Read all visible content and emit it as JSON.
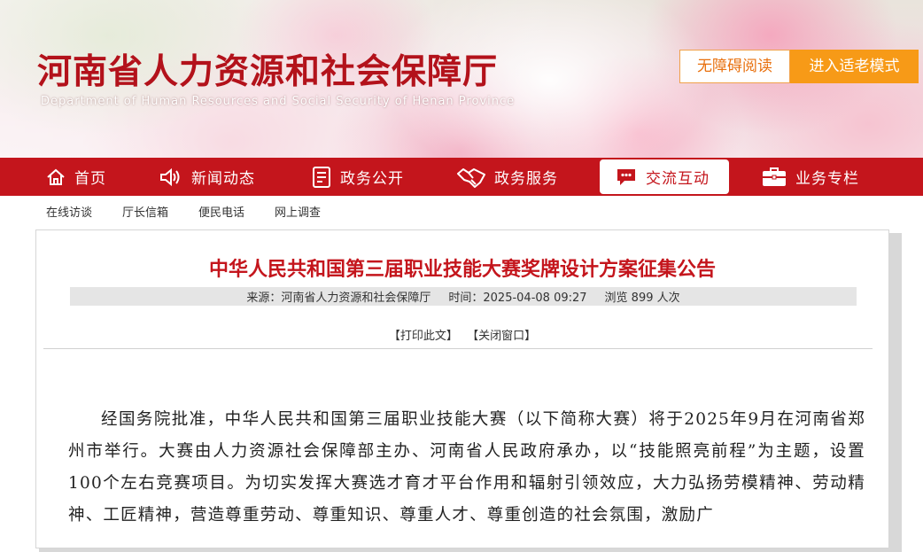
{
  "header": {
    "title": "河南省人力资源和社会保障厅",
    "subtitle": "Department of Human Resources and Social Security of Henan Province",
    "accessibility_label": "无障碍阅读",
    "elder_mode_label": "进入适老模式"
  },
  "nav": {
    "items": [
      {
        "label": "首页",
        "icon": "home-icon"
      },
      {
        "label": "新闻动态",
        "icon": "speaker-icon"
      },
      {
        "label": "政务公开",
        "icon": "document-icon"
      },
      {
        "label": "政务服务",
        "icon": "handshake-icon"
      },
      {
        "label": "交流互动",
        "icon": "chat-icon",
        "active": true
      },
      {
        "label": "业务专栏",
        "icon": "briefcase-icon"
      }
    ]
  },
  "subnav": {
    "items": [
      "在线访谈",
      "厅长信箱",
      "便民电话",
      "网上调查"
    ]
  },
  "article": {
    "title": "中华人民共和国第三届职业技能大赛奖牌设计方案征集公告",
    "source": "来源：河南省人力资源和社会保障厅",
    "time": "时间：2025-04-08 09:27",
    "views": "浏览 899 人次",
    "print_label": "【打印此文】",
    "close_label": "【关闭窗口】",
    "body": "经国务院批准，中华人民共和国第三届职业技能大赛（以下简称大赛）将于2025年9月在河南省郑州市举行。大赛由人力资源社会保障部主办、河南省人民政府承办，以“技能照亮前程”为主题，设置100个左右竞赛项目。为切实发挥大赛选才育才平台作用和辐射引领效应，大力弘扬劳模精神、劳动精神、工匠精神，营造尊重劳动、尊重知识、尊重人才、尊重创造的社会氛围，激励广"
  },
  "colors": {
    "brand_red": "#c4151c",
    "accent_orange": "#f79a17"
  }
}
